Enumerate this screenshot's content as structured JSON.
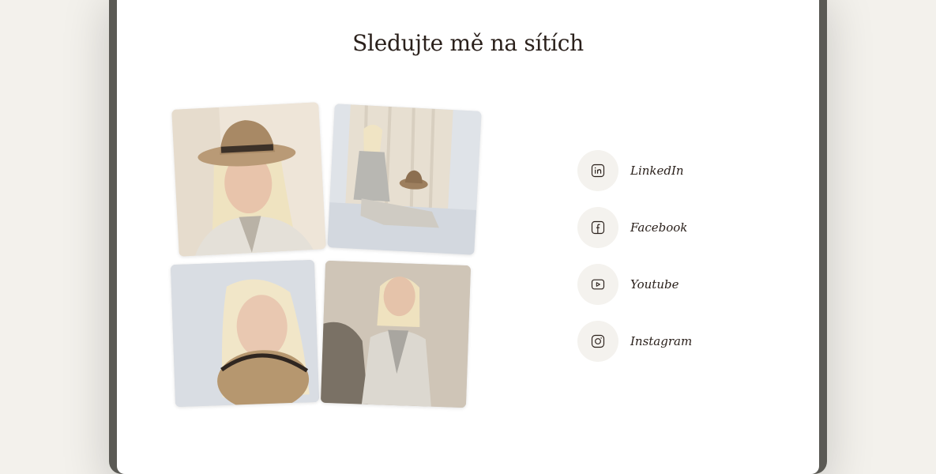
{
  "section": {
    "title": "Sledujte mě na sítích"
  },
  "photos": [
    {
      "name": "photo-woman-hat-portrait"
    },
    {
      "name": "photo-woman-seated-with-hat"
    },
    {
      "name": "photo-woman-holding-hat"
    },
    {
      "name": "photo-woman-standing-blazer"
    }
  ],
  "social": {
    "items": [
      {
        "label": "LinkedIn",
        "icon": "linkedin-icon"
      },
      {
        "label": "Facebook",
        "icon": "facebook-icon"
      },
      {
        "label": "Youtube",
        "icon": "youtube-icon"
      },
      {
        "label": "Instagram",
        "icon": "instagram-icon"
      }
    ]
  },
  "colors": {
    "text": "#2a201b",
    "icon_bg": "#f4f2ee",
    "page_bg": "#f3f1ec",
    "frame": "#5b5a55"
  }
}
